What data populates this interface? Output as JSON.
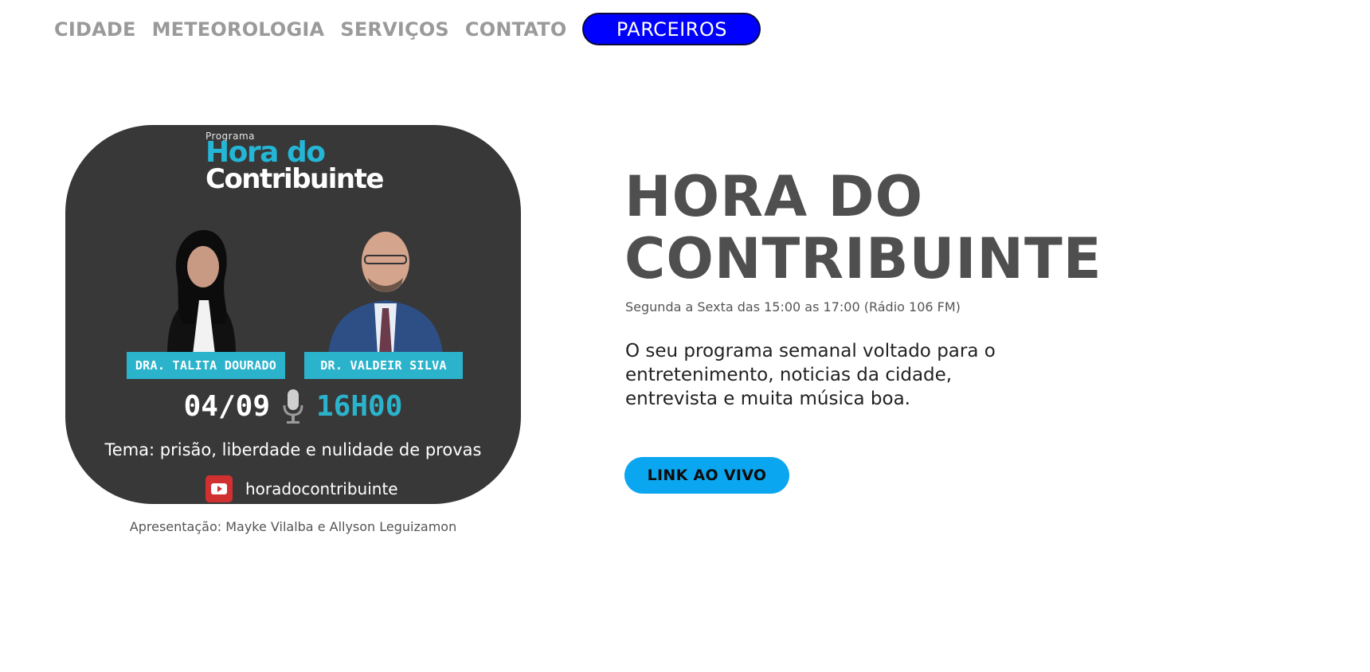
{
  "nav": {
    "items": [
      {
        "label": "CIDADE"
      },
      {
        "label": "METEOROLOGIA"
      },
      {
        "label": "SERVIÇOS"
      },
      {
        "label": "CONTATO"
      }
    ],
    "cta_label": "PARCEIROS",
    "cta_color": "#0000ff"
  },
  "promo": {
    "kicker": "Programa",
    "title_line1": "Hora do",
    "title_line2": "Contribuinte",
    "host_left": "DRA. TALITA DOURADO",
    "host_right": "DR. VALDEIR SILVA",
    "date": "04/09",
    "time": "16H00",
    "theme": "Tema: prisão, liberdade e nulidade de provas",
    "channel": "horadocontribuinte",
    "accent_color": "#2bb3cc",
    "background_color": "#383838"
  },
  "caption": "Apresentação: Mayke Vilalba e Allyson Leguizamon",
  "hero": {
    "title_line1": "HORA DO",
    "title_line2": "CONTRIBUINTE",
    "schedule": "Segunda a Sexta das 15:00 as 17:00 (Rádio 106 FM)",
    "description": "O seu programa semanal voltado para o entretenimento, noticias da cidade, entrevista e muita música boa.",
    "button_label": "LINK AO VIVO",
    "button_color": "#0aa6f0"
  }
}
